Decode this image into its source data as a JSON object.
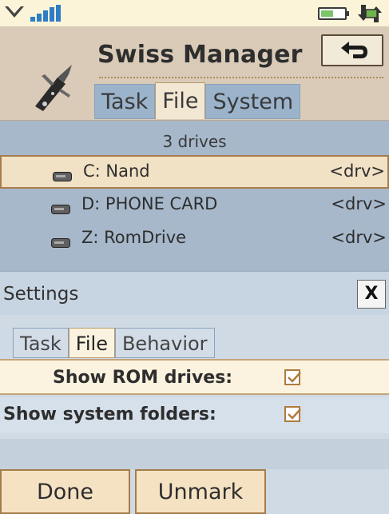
{
  "status_bar": {
    "signal_icon": "signal-strength-icon",
    "battery_icon": "battery-icon",
    "battery_level": 0.55,
    "connection_icon": "data-connection-icon"
  },
  "header": {
    "app_title": "Swiss Manager",
    "logo_icon": "swiss-knife-icon",
    "back_icon": "back-arrow-icon",
    "tabs": [
      {
        "label": "Task",
        "active": false
      },
      {
        "label": "File",
        "active": true
      },
      {
        "label": "System",
        "active": false
      }
    ]
  },
  "drives": {
    "count_label": "3 drives",
    "items": [
      {
        "name": "C: Nand",
        "type": "<drv>",
        "selected": true
      },
      {
        "name": "D: PHONE CARD",
        "type": "<drv>",
        "selected": false
      },
      {
        "name": "Z: RomDrive",
        "type": "<drv>",
        "selected": false
      }
    ]
  },
  "settings": {
    "title": "Settings",
    "close_label": "X",
    "tabs": [
      {
        "label": "Task",
        "active": false
      },
      {
        "label": "File",
        "active": true
      },
      {
        "label": "Behavior",
        "active": false
      }
    ],
    "options": [
      {
        "label": "Show ROM drives:",
        "checked": true
      },
      {
        "label": "Show system folders:",
        "checked": true
      }
    ]
  },
  "softkeys": {
    "left": "Done",
    "right": "Unmark"
  },
  "colors": {
    "accent": "#a57d4b",
    "selection": "#f1e1c5",
    "tab_inactive": "#9bb3cb"
  }
}
